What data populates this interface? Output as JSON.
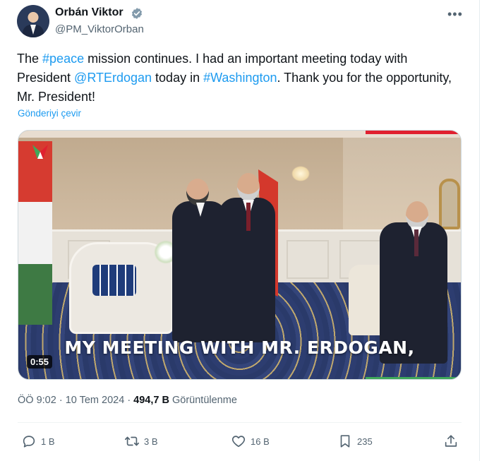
{
  "author": {
    "name": "Orbán Viktor",
    "handle": "@PM_ViktorOrban"
  },
  "tweet": {
    "segments": [
      {
        "text": "The ",
        "link": false
      },
      {
        "text": "#peace",
        "link": true
      },
      {
        "text": " mission continues. I had an important meeting today with President ",
        "link": false
      },
      {
        "text": "@RTErdogan",
        "link": true
      },
      {
        "text": " today in ",
        "link": false
      },
      {
        "text": "#Washington",
        "link": true
      },
      {
        "text": ". Thank you for the opportunity, Mr. President!",
        "link": false
      }
    ],
    "translate_label": "Gönderiyi çevir"
  },
  "video": {
    "caption": "MY MEETING WITH MR. ERDOGAN,",
    "duration": "0:55"
  },
  "meta": {
    "time": "ÖÖ 9:02",
    "date": "10 Tem 2024",
    "views_count": "494,7 B",
    "views_label": "Görüntülenme"
  },
  "actions": {
    "replies": "1 B",
    "reposts": "3 B",
    "likes": "16 B",
    "bookmarks": "235"
  },
  "colors": {
    "link": "#1d9bf0",
    "verified": "#829aab",
    "text": "#0f1419",
    "secondary": "#536471"
  },
  "icons": {
    "more": "more-icon",
    "verified": "verified-badge-icon",
    "reply": "reply-icon",
    "repost": "repost-icon",
    "like": "heart-icon",
    "bookmark": "bookmark-icon",
    "share": "share-icon"
  }
}
